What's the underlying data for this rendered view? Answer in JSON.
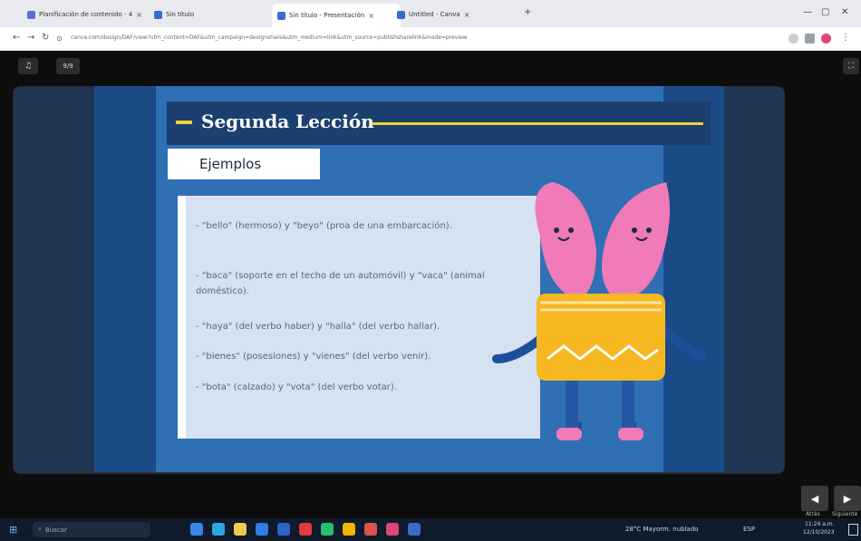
{
  "browser": {
    "tabs": [
      {
        "title": "Planificación de contenido - 4",
        "color": "#5a6fd6"
      },
      {
        "title": "Sin título",
        "color": "#3b6bc9"
      },
      {
        "title": "Sin título - Presentación",
        "color": "#3b6bc9",
        "active": true
      },
      {
        "title": "Untitled - Canva",
        "color": "#3b6bc9"
      }
    ],
    "tab_close": "×",
    "new_tab": "+",
    "url": "canva.com/design/DAF/view?utm_content=DAF&utm_campaign=designshare&utm_medium=link&utm_source=publishsharelink&mode=preview",
    "window_controls": [
      "—",
      "▢",
      "✕"
    ]
  },
  "viewer": {
    "top_left_buttons": [
      "♫",
      "9/9"
    ],
    "fullscreen_icon": "⛶",
    "prev_label": "Atrás",
    "next_label": "Siguiente"
  },
  "slide": {
    "title": "Segunda Lección",
    "subtitle": "Ejemplos",
    "bullets": [
      "- \"bello\" (hermoso) y \"beyo\" (proa de una embarcación).",
      "- \"baca\" (soporte en el techo de un automóvil) y \"vaca\" (animal doméstico).",
      "- \"haya\" (del verbo haber) y \"halla\" (del verbo hallar).",
      "- \"bienes\" (posesiones) y \"vienes\" (del verbo venir).",
      "- \"bota\" (calzado) y \"vota\" (del verbo votar)."
    ]
  },
  "taskbar": {
    "search_placeholder": "Buscar",
    "weather": "28°C  Mayorm. nublado",
    "language": "ESP",
    "time": "11:24 a.m.",
    "date": "12/10/2023"
  },
  "colors": {
    "slide_dark": "#1a4b86",
    "slide_mid": "#2f6fb4",
    "title_bar": "#1b3f6e",
    "accent_yellow": "#f2d23a",
    "content_box": "#d6e2f2",
    "pot_yellow": "#f5b820",
    "petal_pink": "#f07bb8"
  }
}
